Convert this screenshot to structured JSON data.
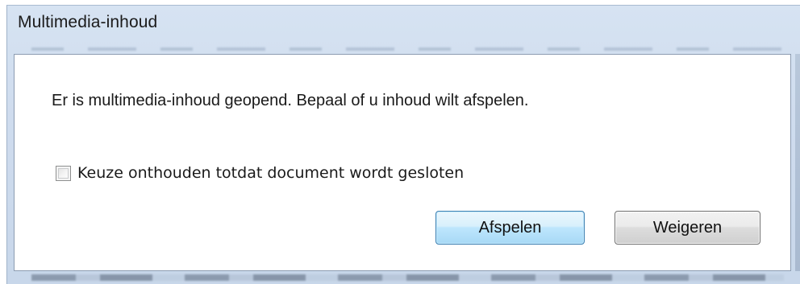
{
  "dialog": {
    "title": "Multimedia-inhoud",
    "message": "Er is multimedia-inhoud geopend.  Bepaal of u inhoud wilt afspelen.",
    "remember_checkbox": {
      "label": "Keuze onthouden totdat document wordt gesloten",
      "checked": false
    },
    "buttons": {
      "play_label": "Afspelen",
      "refuse_label": "Weigeren"
    }
  },
  "colors": {
    "frame": "#cfdcee",
    "primary_button_border": "#3c7fb1",
    "primary_button_fill": "#bee6fd",
    "secondary_button_border": "#707070"
  }
}
